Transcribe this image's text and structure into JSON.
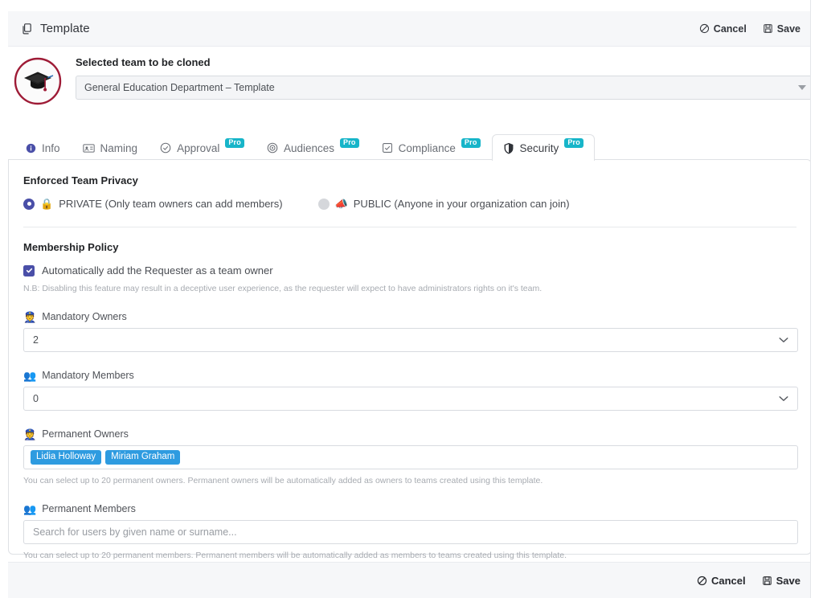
{
  "header": {
    "title": "Template",
    "title_icon": "copy-icon",
    "cancel_label": "Cancel",
    "save_label": "Save",
    "cancel_icon": "ban-icon",
    "save_icon": "floppy-disk-icon"
  },
  "team": {
    "avatar_icon": "graduation-cap-icon",
    "avatar_color": "#9e1b36",
    "label": "Selected team to be cloned",
    "selected_value": "General Education Department – Template",
    "caret_icon": "triangle-down-icon"
  },
  "tabs": [
    {
      "label": "Info",
      "icon": "info-circle-icon",
      "pro": false,
      "active": false
    },
    {
      "label": "Naming",
      "icon": "id-card-icon",
      "pro": false,
      "active": false
    },
    {
      "label": "Approval",
      "icon": "check-circle-icon",
      "pro": true,
      "active": false
    },
    {
      "label": "Audiences",
      "icon": "target-icon",
      "pro": true,
      "active": false
    },
    {
      "label": "Compliance",
      "icon": "checkbox-icon",
      "pro": true,
      "active": false
    },
    {
      "label": "Security",
      "icon": "shield-icon",
      "pro": true,
      "active": true
    }
  ],
  "pro_badge_label": "Pro",
  "pro_badge_color": "#17b5c9",
  "accent_color": "#4a4fa8",
  "chip_color": "#2e9be0",
  "security": {
    "privacy_title": "Enforced Team Privacy",
    "privacy_options": [
      {
        "label": "PRIVATE (Only team owners can add members)",
        "emoji": "🔒",
        "icon": "lock-icon",
        "selected": true
      },
      {
        "label": "PUBLIC (Anyone in your organization can join)",
        "emoji": "📣",
        "icon": "megaphone-icon",
        "selected": false
      }
    ],
    "membership_title": "Membership Policy",
    "auto_owner_label": "Automatically add the Requester as a team owner",
    "auto_owner_checked": true,
    "auto_owner_note": "N.B: Disabling this feature may result in a deceptive user experience, as the requester will expect to have administrators rights on it's team.",
    "mandatory_owners": {
      "label": "Mandatory Owners",
      "emoji": "👮",
      "icon": "person-icon",
      "value": "2"
    },
    "mandatory_members": {
      "label": "Mandatory Members",
      "emoji": "👥",
      "icon": "people-icon",
      "value": "0"
    },
    "permanent_owners": {
      "label": "Permanent Owners",
      "emoji": "👮",
      "icon": "person-icon",
      "chips": [
        "Lidia Holloway",
        "Miriam Graham"
      ],
      "help": "You can select up to 20 permanent owners. Permanent owners will be automatically added as owners to teams created using this template."
    },
    "permanent_members": {
      "label": "Permanent Members",
      "emoji": "👥",
      "icon": "people-icon",
      "placeholder": "Search for users by given name or surname...",
      "value": "",
      "help": "You can select up to 20 permanent members. Permanent members will be automatically added as members to teams created using this template."
    }
  },
  "footer": {
    "cancel_label": "Cancel",
    "save_label": "Save"
  }
}
